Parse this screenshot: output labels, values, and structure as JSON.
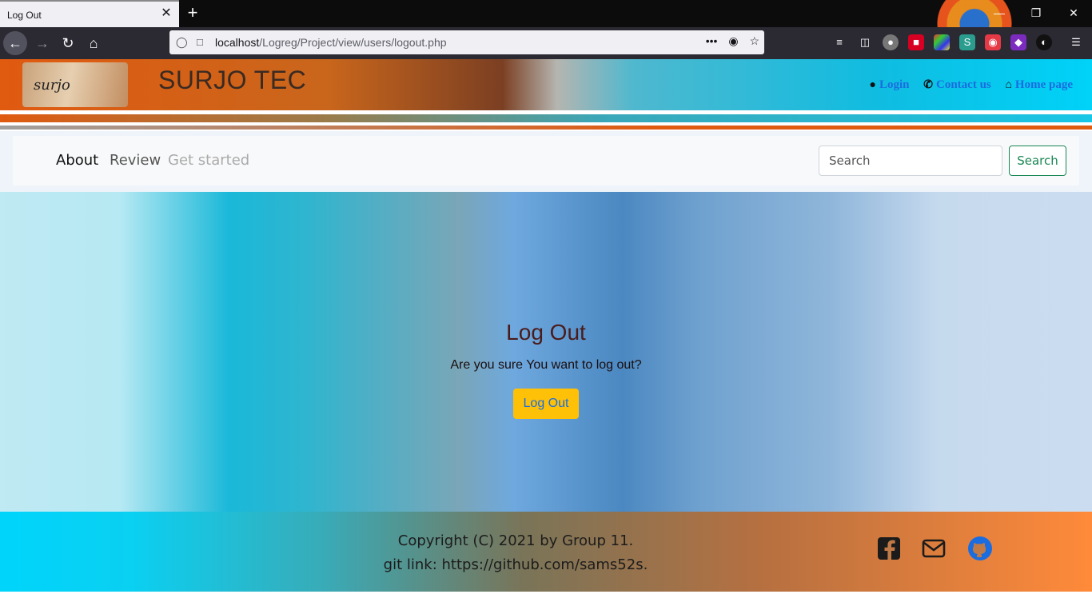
{
  "browser": {
    "tab_title": "Log Out",
    "tab_close": "✕",
    "new_tab": "+",
    "url_host": "localhost",
    "url_path": "/Logreg/Project/view/users/logout.php",
    "url_more": "•••",
    "window_minimize": "—",
    "window_restore": "❐",
    "window_close": "✕"
  },
  "header": {
    "logo_text": "surjo",
    "brand": "SURJO TEC",
    "links": [
      {
        "label": "Login",
        "icon": "user-icon"
      },
      {
        "label": "Contact us",
        "icon": "phone-icon"
      },
      {
        "label": "Home page",
        "icon": "home-icon"
      }
    ]
  },
  "menu": {
    "items": [
      "About",
      "Review",
      "Get started"
    ],
    "search_placeholder": "Search",
    "search_button": "Search"
  },
  "main": {
    "title": "Log Out",
    "question": "Are you sure You want to log out?",
    "button": "Log Out"
  },
  "footer": {
    "copyright": "Copyright (C) 2021 by Group 11.",
    "git": "git link: https://github.com/sams52s.",
    "social": [
      "facebook-icon",
      "mail-icon",
      "github-icon"
    ]
  },
  "colors": {
    "accent_yellow": "#ffc107",
    "link_blue": "#1a6de0",
    "search_green": "#198754",
    "title_maroon": "#4a1b1b"
  }
}
